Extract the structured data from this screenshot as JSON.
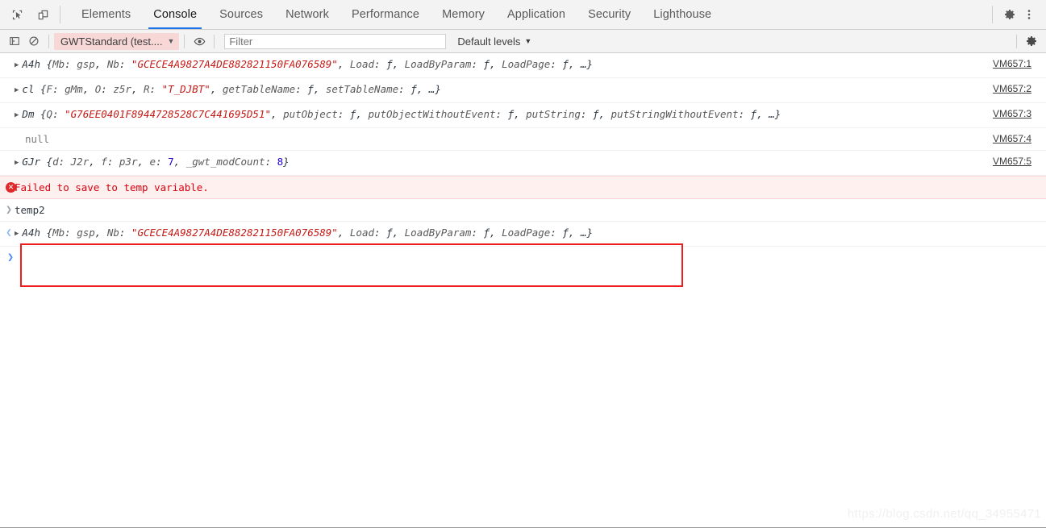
{
  "window": {
    "title": "Chrome DevTools Console"
  },
  "toolbar": {
    "inspect_icon": "inspect-element-icon",
    "device_icon": "device-toolbar-icon",
    "settings_icon": "gear-icon",
    "more_icon": "more-vertical-icon",
    "tabs": [
      {
        "label": "Elements",
        "active": false
      },
      {
        "label": "Console",
        "active": true
      },
      {
        "label": "Sources",
        "active": false
      },
      {
        "label": "Network",
        "active": false
      },
      {
        "label": "Performance",
        "active": false
      },
      {
        "label": "Memory",
        "active": false
      },
      {
        "label": "Application",
        "active": false
      },
      {
        "label": "Security",
        "active": false
      },
      {
        "label": "Lighthouse",
        "active": false
      }
    ]
  },
  "filterbar": {
    "sidebar_icon": "show-console-sidebar-icon",
    "clear_icon": "clear-console-icon",
    "context_label": "GWTStandard (test....",
    "context_caret": "▼",
    "eye_icon": "live-expression-eye-icon",
    "filter_placeholder": "Filter",
    "filter_value": "",
    "levels_label": "Default levels",
    "levels_caret": "▼",
    "settings_icon": "console-settings-gear-icon",
    "context_bg": "#f8d7d7"
  },
  "console": {
    "messages": [
      {
        "gutter": "",
        "arrow": "▶",
        "kind": "object",
        "link": "VM657:1",
        "parts": [
          {
            "t": "A4h ",
            "c": "tok-cls"
          },
          {
            "t": "{",
            "c": "tok-punc"
          },
          {
            "t": "Mb",
            "c": "tok-key"
          },
          {
            "t": ": ",
            "c": "tok-punc"
          },
          {
            "t": "gsp",
            "c": "tok-key"
          },
          {
            "t": ", ",
            "c": "tok-punc"
          },
          {
            "t": "Nb",
            "c": "tok-key"
          },
          {
            "t": ": ",
            "c": "tok-punc"
          },
          {
            "t": "\"GCECE4A9827A4DE882821150FA076589\"",
            "c": "tok-str"
          },
          {
            "t": ", ",
            "c": "tok-punc"
          },
          {
            "t": "Load",
            "c": "tok-key"
          },
          {
            "t": ": ",
            "c": "tok-punc"
          },
          {
            "t": "ƒ",
            "c": "tok-fn"
          },
          {
            "t": ", ",
            "c": "tok-punc"
          },
          {
            "t": "LoadByParam",
            "c": "tok-key"
          },
          {
            "t": ": ",
            "c": "tok-punc"
          },
          {
            "t": "ƒ",
            "c": "tok-fn"
          },
          {
            "t": ", ",
            "c": "tok-punc"
          },
          {
            "t": "LoadPage",
            "c": "tok-key"
          },
          {
            "t": ": ",
            "c": "tok-punc"
          },
          {
            "t": "ƒ",
            "c": "tok-fn"
          },
          {
            "t": ", …}",
            "c": "tok-punc"
          }
        ]
      },
      {
        "gutter": "",
        "arrow": "▶",
        "kind": "object",
        "link": "VM657:2",
        "parts": [
          {
            "t": "cl ",
            "c": "tok-cls"
          },
          {
            "t": "{",
            "c": "tok-punc"
          },
          {
            "t": "F",
            "c": "tok-key"
          },
          {
            "t": ": ",
            "c": "tok-punc"
          },
          {
            "t": "gMm",
            "c": "tok-key"
          },
          {
            "t": ", ",
            "c": "tok-punc"
          },
          {
            "t": "O",
            "c": "tok-key"
          },
          {
            "t": ": ",
            "c": "tok-punc"
          },
          {
            "t": "z5r",
            "c": "tok-key"
          },
          {
            "t": ", ",
            "c": "tok-punc"
          },
          {
            "t": "R",
            "c": "tok-key"
          },
          {
            "t": ": ",
            "c": "tok-punc"
          },
          {
            "t": "\"T_DJBT\"",
            "c": "tok-str"
          },
          {
            "t": ", ",
            "c": "tok-punc"
          },
          {
            "t": "getTableName",
            "c": "tok-key"
          },
          {
            "t": ": ",
            "c": "tok-punc"
          },
          {
            "t": "ƒ",
            "c": "tok-fn"
          },
          {
            "t": ", ",
            "c": "tok-punc"
          },
          {
            "t": "setTableName",
            "c": "tok-key"
          },
          {
            "t": ": ",
            "c": "tok-punc"
          },
          {
            "t": "ƒ",
            "c": "tok-fn"
          },
          {
            "t": ", …}",
            "c": "tok-punc"
          }
        ]
      },
      {
        "gutter": "",
        "arrow": "▶",
        "kind": "object",
        "link": "VM657:3",
        "parts": [
          {
            "t": "Dm ",
            "c": "tok-cls"
          },
          {
            "t": "{",
            "c": "tok-punc"
          },
          {
            "t": "Q",
            "c": "tok-key"
          },
          {
            "t": ": ",
            "c": "tok-punc"
          },
          {
            "t": "\"G76EE0401F8944728528C7C441695D51\"",
            "c": "tok-str"
          },
          {
            "t": ", ",
            "c": "tok-punc"
          },
          {
            "t": "putObject",
            "c": "tok-key"
          },
          {
            "t": ": ",
            "c": "tok-punc"
          },
          {
            "t": "ƒ",
            "c": "tok-fn"
          },
          {
            "t": ", ",
            "c": "tok-punc"
          },
          {
            "t": "putObjectWithoutEvent",
            "c": "tok-key"
          },
          {
            "t": ": ",
            "c": "tok-punc"
          },
          {
            "t": "ƒ",
            "c": "tok-fn"
          },
          {
            "t": ", ",
            "c": "tok-punc"
          },
          {
            "t": "putString",
            "c": "tok-key"
          },
          {
            "t": ": ",
            "c": "tok-punc"
          },
          {
            "t": "ƒ",
            "c": "tok-fn"
          },
          {
            "t": ", ",
            "c": "tok-punc"
          },
          {
            "t": "putStringWithoutEvent",
            "c": "tok-key"
          },
          {
            "t": ": ",
            "c": "tok-punc"
          },
          {
            "t": "ƒ",
            "c": "tok-fn"
          },
          {
            "t": ", …}",
            "c": "tok-punc"
          }
        ]
      },
      {
        "gutter": "",
        "arrow": "",
        "kind": "null",
        "link": "VM657:4",
        "parts": [
          {
            "t": "null",
            "c": "tok-null"
          }
        ]
      },
      {
        "gutter": "",
        "arrow": "▶",
        "kind": "object",
        "link": "VM657:5",
        "parts": [
          {
            "t": "GJr ",
            "c": "tok-cls"
          },
          {
            "t": "{",
            "c": "tok-punc"
          },
          {
            "t": "d",
            "c": "tok-key"
          },
          {
            "t": ": ",
            "c": "tok-punc"
          },
          {
            "t": "J2r",
            "c": "tok-key"
          },
          {
            "t": ", ",
            "c": "tok-punc"
          },
          {
            "t": "f",
            "c": "tok-key"
          },
          {
            "t": ": ",
            "c": "tok-punc"
          },
          {
            "t": "p3r",
            "c": "tok-key"
          },
          {
            "t": ", ",
            "c": "tok-punc"
          },
          {
            "t": "e",
            "c": "tok-key"
          },
          {
            "t": ": ",
            "c": "tok-punc"
          },
          {
            "t": "7",
            "c": "tok-num"
          },
          {
            "t": ", ",
            "c": "tok-punc"
          },
          {
            "t": "_gwt_modCount",
            "c": "tok-key"
          },
          {
            "t": ": ",
            "c": "tok-punc"
          },
          {
            "t": "8",
            "c": "tok-num"
          },
          {
            "t": "}",
            "c": "tok-punc"
          }
        ]
      }
    ],
    "error": {
      "icon": "error-circle-icon",
      "icon_glyph": "✕",
      "text": "Failed to save to temp variable.",
      "color": "#d8000c",
      "background": "#fff0f0"
    },
    "command": {
      "gutter_glyph": "❯",
      "text": "temp2"
    },
    "result": {
      "gutter_glyph": "❮",
      "arrow": "▶",
      "parts": [
        {
          "t": "A4h ",
          "c": "tok-cls"
        },
        {
          "t": "{",
          "c": "tok-punc"
        },
        {
          "t": "Mb",
          "c": "tok-key"
        },
        {
          "t": ": ",
          "c": "tok-punc"
        },
        {
          "t": "gsp",
          "c": "tok-key"
        },
        {
          "t": ", ",
          "c": "tok-punc"
        },
        {
          "t": "Nb",
          "c": "tok-key"
        },
        {
          "t": ": ",
          "c": "tok-punc"
        },
        {
          "t": "\"GCECE4A9827A4DE882821150FA076589\"",
          "c": "tok-str"
        },
        {
          "t": ", ",
          "c": "tok-punc"
        },
        {
          "t": "Load",
          "c": "tok-key"
        },
        {
          "t": ": ",
          "c": "tok-punc"
        },
        {
          "t": "ƒ",
          "c": "tok-fn"
        },
        {
          "t": ", ",
          "c": "tok-punc"
        },
        {
          "t": "LoadByParam",
          "c": "tok-key"
        },
        {
          "t": ": ",
          "c": "tok-punc"
        },
        {
          "t": "ƒ",
          "c": "tok-fn"
        },
        {
          "t": ", ",
          "c": "tok-punc"
        },
        {
          "t": "LoadPage",
          "c": "tok-key"
        },
        {
          "t": ": ",
          "c": "tok-punc"
        },
        {
          "t": "ƒ",
          "c": "tok-fn"
        },
        {
          "t": ", …}",
          "c": "tok-punc"
        }
      ]
    },
    "prompt": {
      "glyph": "❯",
      "value": ""
    },
    "highlight_color": "#ee1c1c"
  },
  "watermark": {
    "text": "https://blog.csdn.net/qq_34955471"
  }
}
